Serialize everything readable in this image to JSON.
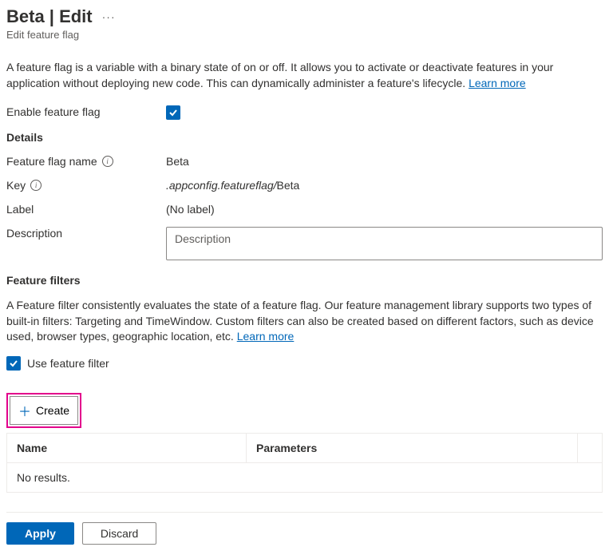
{
  "header": {
    "title": "Beta | Edit",
    "subtitle": "Edit feature flag"
  },
  "intro": {
    "text": "A feature flag is a variable with a binary state of on or off. It allows you to activate or deactivate features in your application without deploying new code. This can dynamically administer a feature's lifecycle. ",
    "learn_more": "Learn more"
  },
  "enable": {
    "label": "Enable feature flag",
    "checked": true
  },
  "details": {
    "heading": "Details",
    "name_label": "Feature flag name",
    "name_value": "Beta",
    "key_label": "Key",
    "key_prefix": ".appconfig.featureflag/",
    "key_value": "Beta",
    "label_label": "Label",
    "label_value": "(No label)",
    "desc_label": "Description",
    "desc_placeholder": "Description",
    "desc_value": ""
  },
  "filters": {
    "heading": "Feature filters",
    "intro": "A Feature filter consistently evaluates the state of a feature flag. Our feature management library supports two types of built-in filters: Targeting and TimeWindow. Custom filters can also be created based on different factors, such as device used, browser types, geographic location, etc. ",
    "learn_more": "Learn more",
    "use_filter_label": "Use feature filter",
    "use_filter_checked": true,
    "create_label": "Create",
    "table": {
      "col_name": "Name",
      "col_params": "Parameters",
      "empty": "No results."
    }
  },
  "footer": {
    "apply": "Apply",
    "discard": "Discard"
  }
}
